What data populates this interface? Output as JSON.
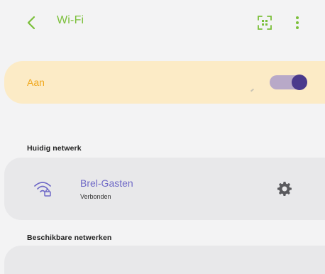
{
  "header": {
    "title": "Wi-Fi",
    "icons": {
      "back": "chevron-left-icon",
      "qr": "qr-scan-icon",
      "more": "more-vertical-icon"
    }
  },
  "master_toggle": {
    "label": "Aan",
    "state": "on"
  },
  "current_network": {
    "section_title": "Huidig netwerk",
    "name": "Brel-Gasten",
    "status": "Verbonden",
    "icons": {
      "signal": "wifi-lock-icon",
      "settings": "gear-icon"
    }
  },
  "available_networks": {
    "section_title": "Beschikbare netwerken"
  },
  "colors": {
    "accent_green": "#7bbf3a",
    "toggle_card_bg": "#fcebc6",
    "toggle_label": "#f0a81d",
    "switch_track": "#b8a9c8",
    "switch_thumb": "#4a3a8c",
    "network_name": "#6f69c7",
    "card_bg": "#e8e8ea",
    "page_bg": "#f3f3f4"
  }
}
